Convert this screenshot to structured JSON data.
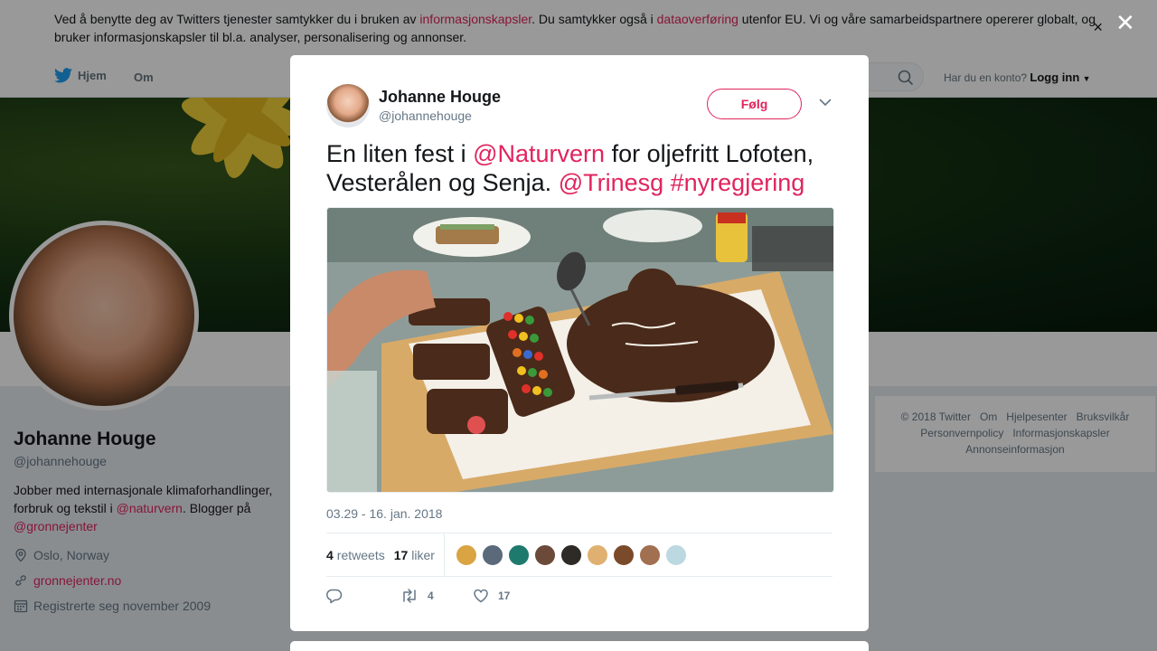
{
  "cookie": {
    "text_1": "Ved å benytte deg av Twitters tjenester samtykker du i bruken av ",
    "link_1": "informasjonskapsler",
    "text_2": ". Du samtykker også i ",
    "link_2": "dataoverføring",
    "text_3": " utenfor EU. Vi og våre samarbeidspartnere opererer globalt, og bruker informasjonskapsler til bl.a. analyser, personalisering og annonser.",
    "close": "×"
  },
  "nav": {
    "home": "Hjem",
    "about": "Om",
    "login_prompt": "Har du en konto?",
    "login": "Logg inn"
  },
  "profile": {
    "name": "Johanne Houge",
    "handle": "@johannehouge",
    "bio_1": "Jobber med internasjonale klimaforhandlinger, forbruk og tekstil i ",
    "bio_link_1": "@naturvern",
    "bio_2": ". Blogger på ",
    "bio_link_2": "@gronnejenter",
    "location": "Oslo, Norway",
    "website": "gronnejenter.no",
    "joined": "Registrerte seg november 2009"
  },
  "footer": {
    "items": [
      "© 2018 Twitter",
      "Om",
      "Hjelpesenter",
      "Bruksvilkår",
      "Personvernpolicy",
      "Informasjonskapsler",
      "Annonseinformasjon"
    ]
  },
  "overlay": {
    "close": "✕"
  },
  "tweet": {
    "author_name": "Johanne Houge",
    "author_handle": "@johannehouge",
    "follow_label": "Følg",
    "text_1": "En liten fest i ",
    "mention_1": "@Naturvern",
    "text_2": " for oljefritt Lofoten, Vesterålen og Senja. ",
    "mention_2": "@Trinesg",
    "hashtag": "#nyregjering",
    "timestamp": "03.29 - 16. jan. 2018",
    "retweets_count": "4",
    "retweets_label": "retweets",
    "likes_count": "17",
    "likes_label": "liker",
    "action_retweets": "4",
    "action_likes": "17"
  },
  "colors": {
    "accent": "#e0245e",
    "text": "#14171a",
    "muted": "#657786",
    "twitter_blue": "#1da1f2"
  },
  "liker_colors": [
    "#d9a441",
    "#5a6a7a",
    "#1f7a6e",
    "#6b4a3a",
    "#2e2a26",
    "#e0b070",
    "#7a4a2a",
    "#a07050",
    "#bcd8e0"
  ]
}
